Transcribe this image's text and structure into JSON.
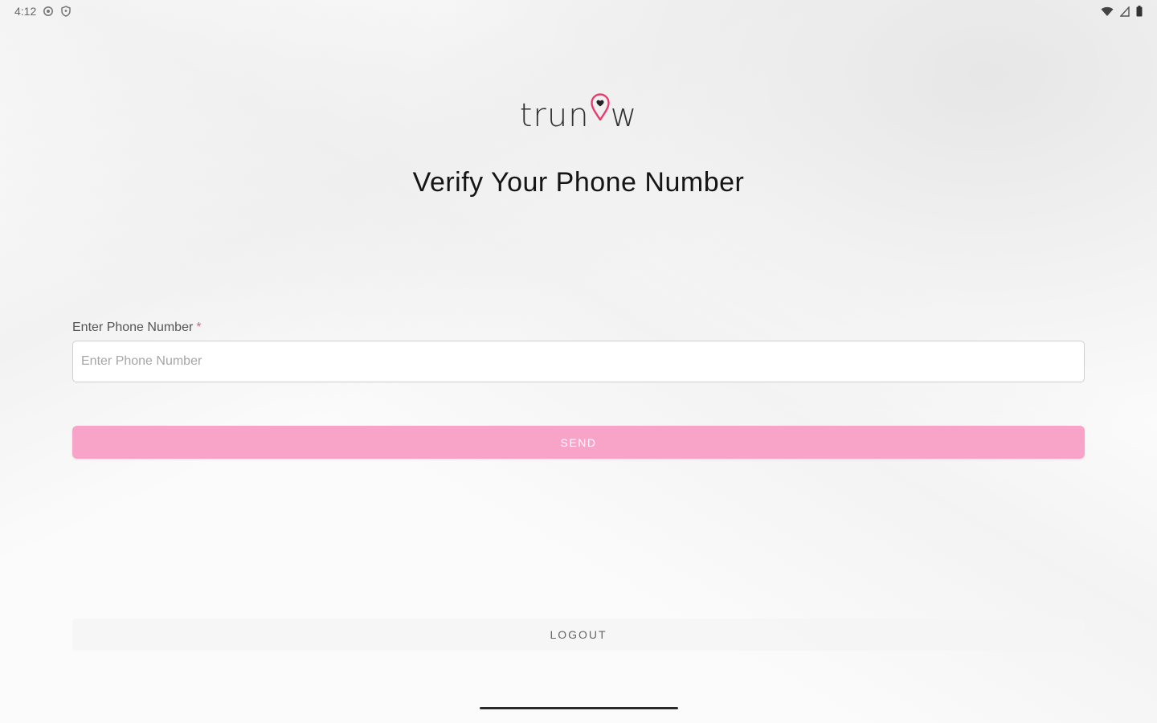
{
  "status_bar": {
    "time": "4:12",
    "left_icons": [
      "settings-gear-icon",
      "shield-icon"
    ],
    "right_icons": [
      "wifi-icon",
      "signal-icon",
      "battery-icon"
    ]
  },
  "logo": {
    "text_before": "trun",
    "text_after": "w",
    "pin_icon": "location-pin-heart-icon",
    "accent_color": "#ea3b6f"
  },
  "title": "Verify Your Phone Number",
  "phone_field": {
    "label": "Enter Phone Number",
    "required_marker": "*",
    "value": "",
    "placeholder": "Enter Phone Number"
  },
  "send_button": {
    "label": "SEND",
    "color": "#f7a4c8"
  },
  "logout_button": {
    "label": "LOGOUT"
  },
  "colors": {
    "accent": "#ea5a8b",
    "background": "#fbfbfb"
  }
}
